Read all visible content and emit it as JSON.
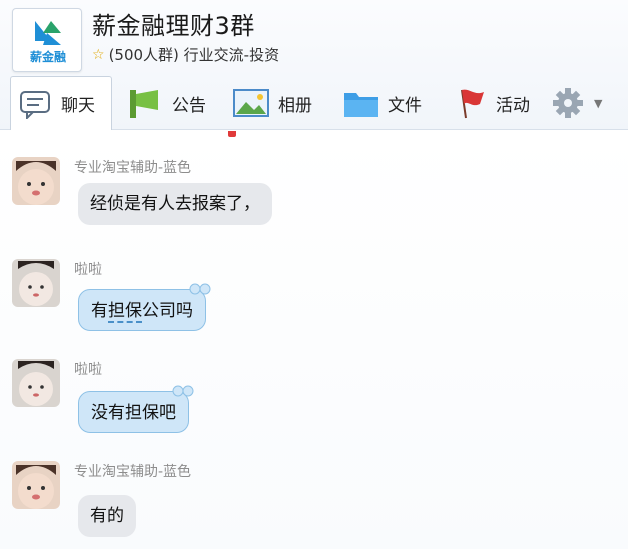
{
  "header": {
    "title": "薪金融理财3群",
    "meta": "(500人群) 行业交流-投资",
    "logo_text": "薪金融"
  },
  "toolbar": {
    "chat": "聊天",
    "notice": "公告",
    "album": "相册",
    "files": "文件",
    "activity": "活动"
  },
  "messages": [
    {
      "sender": "专业淘宝辅助-蓝色",
      "text": "经侦是有人去报案了，"
    },
    {
      "sender": "啦啦",
      "text_a": "有",
      "text_b": "担保",
      "text_c": "公司吗"
    },
    {
      "sender": "啦啦",
      "text": "没有担保吧"
    },
    {
      "sender": "专业淘宝辅助-蓝色",
      "text": "有的"
    }
  ]
}
